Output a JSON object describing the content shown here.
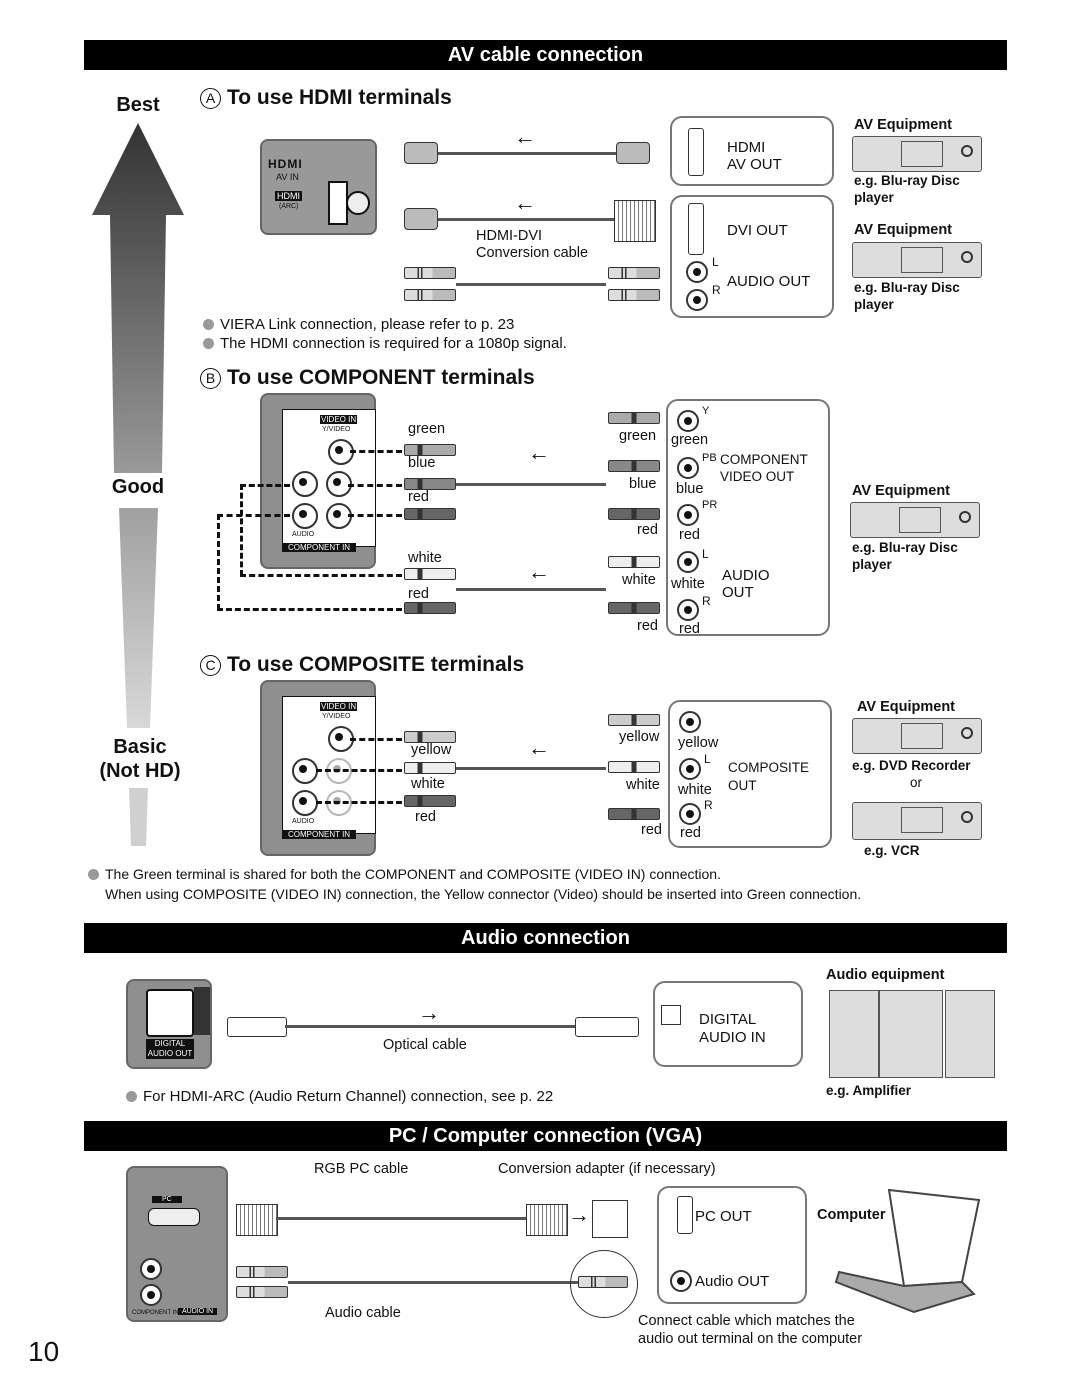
{
  "page_number": "10",
  "sections": {
    "av": "AV cable connection",
    "audio": "Audio connection",
    "pc": "PC / Computer connection (VGA)"
  },
  "quality_scale": {
    "best": "Best",
    "good": "Good",
    "basic_line1": "Basic",
    "basic_line2": "(Not HD)"
  },
  "hdmi": {
    "marker": "A",
    "title": "To use HDMI terminals",
    "panel_logo": "HDMI",
    "panel_av_in": "AV IN",
    "panel_hdmi_label": "HDMI",
    "panel_arc": "(ARC)",
    "cable_label_1": "HDMI-DVI",
    "cable_label_2": "Conversion cable",
    "callout1_line1": "HDMI",
    "callout1_line2": "AV OUT",
    "callout2_dvi": "DVI OUT",
    "callout2_l": "L",
    "callout2_r": "R",
    "callout2_audio": "AUDIO OUT",
    "equip1_title": "AV Equipment",
    "equip1_eg1": "e.g. Blu-ray Disc",
    "equip1_eg2": "player",
    "equip2_title": "AV Equipment",
    "equip2_eg1": "e.g. Blu-ray Disc",
    "equip2_eg2": "player",
    "notes": [
      "VIERA Link connection, please refer to p. 23",
      "The HDMI connection is required for a 1080p signal."
    ]
  },
  "component": {
    "marker": "B",
    "title": "To use COMPONENT terminals",
    "panel_video_in": "VIDEO IN",
    "panel_yvideo": "Y/VIDEO",
    "panel_audio": "AUDIO",
    "panel_component_in": "COMPONENT IN",
    "left_labels": [
      "green",
      "blue",
      "red",
      "white",
      "red"
    ],
    "right_plug_labels": [
      "green",
      "blue",
      "red",
      "white",
      "red"
    ],
    "jack_labels": [
      "green",
      "blue",
      "red",
      "white",
      "red"
    ],
    "jack_sup": [
      "Y",
      "PB",
      "PR",
      "L",
      "R"
    ],
    "callout_video_1": "COMPONENT",
    "callout_video_2": "VIDEO OUT",
    "callout_audio_1": "AUDIO",
    "callout_audio_2": "OUT",
    "equip_title": "AV Equipment",
    "equip_eg1": "e.g. Blu-ray Disc",
    "equip_eg2": "player"
  },
  "composite": {
    "marker": "C",
    "title": "To use COMPOSITE terminals",
    "left_labels": [
      "yellow",
      "white",
      "red"
    ],
    "right_plug_labels": [
      "yellow",
      "white",
      "red"
    ],
    "jack_labels": [
      "yellow",
      "white",
      "red"
    ],
    "jack_sup": [
      "",
      "L",
      "R"
    ],
    "callout_1": "COMPOSITE",
    "callout_2": "OUT",
    "equip_title": "AV Equipment",
    "equip_eg1": "e.g. DVD Recorder",
    "equip_or": "or",
    "equip_eg2": "e.g. VCR"
  },
  "green_note": {
    "line1": "The Green terminal is shared for both the COMPONENT and COMPOSITE (VIDEO IN) connection.",
    "line2": "When using COMPOSITE (VIDEO IN) connection, the Yellow connector (Video) should be inserted into Green connection."
  },
  "audio": {
    "panel_label_1": "DIGITAL",
    "panel_label_2": "AUDIO OUT",
    "cable_label": "Optical cable",
    "callout_1": "DIGITAL",
    "callout_2": "AUDIO IN",
    "equip_title": "Audio equipment",
    "equip_eg": "e.g. Amplifier",
    "note": "For HDMI-ARC (Audio Return Channel) connection, see p. 22"
  },
  "pc": {
    "panel_pc": "PC",
    "panel_audio_in": "AUDIO IN",
    "panel_component_in": "COMPONENT IN",
    "rgb_cable": "RGB PC cable",
    "adapter": "Conversion adapter (if necessary)",
    "audio_cable": "Audio cable",
    "callout_pc_out": "PC OUT",
    "callout_audio_out": "Audio OUT",
    "computer": "Computer",
    "match_note_1": "Connect cable which matches the",
    "match_note_2": "audio out terminal on the computer"
  }
}
